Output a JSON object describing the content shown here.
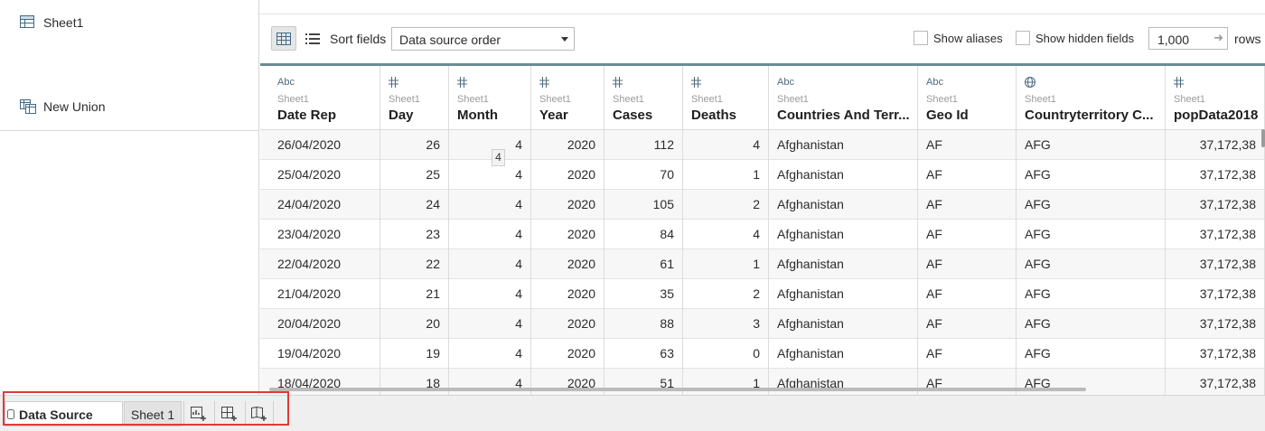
{
  "left_pane": {
    "items": [
      {
        "label": "Sheet1",
        "icon": "sheet-grid-icon"
      },
      {
        "label": "New Union",
        "icon": "union-icon"
      }
    ]
  },
  "toolbar": {
    "sort_label": "Sort fields",
    "sort_value": "Data source order",
    "show_aliases": "Show aliases",
    "show_hidden": "Show hidden fields",
    "rows_value": "1,000",
    "rows_label": "rows"
  },
  "columns": [
    {
      "type": "Abc",
      "source": "Sheet1",
      "name": "Date Rep"
    },
    {
      "type": "#",
      "source": "Sheet1",
      "name": "Day"
    },
    {
      "type": "#",
      "source": "Sheet1",
      "name": "Month"
    },
    {
      "type": "#",
      "source": "Sheet1",
      "name": "Year"
    },
    {
      "type": "#",
      "source": "Sheet1",
      "name": "Cases"
    },
    {
      "type": "#",
      "source": "Sheet1",
      "name": "Deaths"
    },
    {
      "type": "Abc",
      "source": "Sheet1",
      "name": "Countries And Terr..."
    },
    {
      "type": "Abc",
      "source": "Sheet1",
      "name": "Geo Id"
    },
    {
      "type": "globe",
      "source": "Sheet1",
      "name": "Countryterritory C..."
    },
    {
      "type": "#",
      "source": "Sheet1",
      "name": "popData2018"
    }
  ],
  "rows": [
    [
      "26/04/2020",
      "26",
      "4",
      "2020",
      "112",
      "4",
      "Afghanistan",
      "AF",
      "AFG",
      "37,172,38"
    ],
    [
      "25/04/2020",
      "25",
      "4",
      "2020",
      "70",
      "1",
      "Afghanistan",
      "AF",
      "AFG",
      "37,172,38"
    ],
    [
      "24/04/2020",
      "24",
      "4",
      "2020",
      "105",
      "2",
      "Afghanistan",
      "AF",
      "AFG",
      "37,172,38"
    ],
    [
      "23/04/2020",
      "23",
      "4",
      "2020",
      "84",
      "4",
      "Afghanistan",
      "AF",
      "AFG",
      "37,172,38"
    ],
    [
      "22/04/2020",
      "22",
      "4",
      "2020",
      "61",
      "1",
      "Afghanistan",
      "AF",
      "AFG",
      "37,172,38"
    ],
    [
      "21/04/2020",
      "21",
      "4",
      "2020",
      "35",
      "2",
      "Afghanistan",
      "AF",
      "AFG",
      "37,172,38"
    ],
    [
      "20/04/2020",
      "20",
      "4",
      "2020",
      "88",
      "3",
      "Afghanistan",
      "AF",
      "AFG",
      "37,172,38"
    ],
    [
      "19/04/2020",
      "19",
      "4",
      "2020",
      "63",
      "0",
      "Afghanistan",
      "AF",
      "AFG",
      "37,172,38"
    ],
    [
      "18/04/2020",
      "18",
      "4",
      "2020",
      "51",
      "1",
      "Afghanistan",
      "AF",
      "AFG",
      "37,172,38"
    ]
  ],
  "tooltip": "4",
  "tabs": {
    "data_source": "Data Source",
    "sheet1": "Sheet 1",
    "icons": [
      "new-worksheet-icon",
      "new-dashboard-icon",
      "new-story-icon"
    ]
  },
  "colors": {
    "header_rule": "#6c8a97",
    "highlight": "#e03a3a",
    "type_icon": "#4c6a80"
  }
}
